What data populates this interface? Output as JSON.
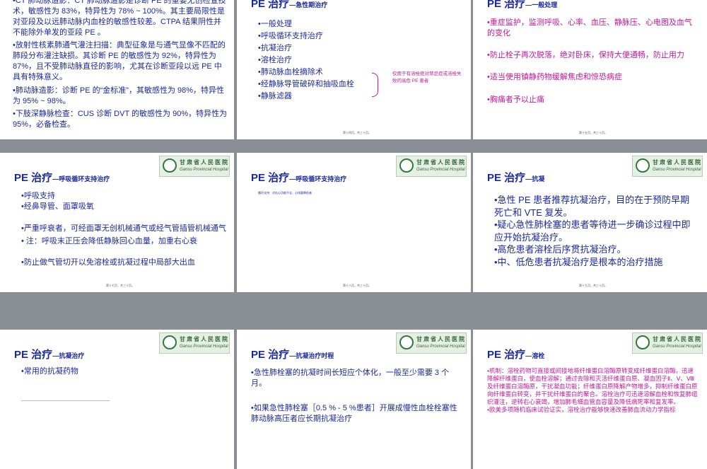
{
  "slides": [
    {
      "bullets": [
        "•CT 肺动脉造影：CT 肺动脉造影是诊断 PE 的重要无创检查技术，敏感性为 83%，特异性为 78% ~ 100%。其主要局限性是对亚段及以远肺动脉内血栓的敏感性较差。CTPA 结果阴性并不能除外单发的亚段 PE 。",
        "•放射性核素肺通气灌注扫描：典型征象是与通气显像不匹配的肺段分布灌注缺损。其诊断 PE 的敏感性为 92%，特异性为 87%，且不受肺动脉直径的影响，尤其在诊断亚段以远 PE 中具有特殊意义。",
        "•肺动脉造影：诊断 PE 的“金标准”，其敏感性为 98%，特异性为 95% ~ 98%。",
        "•下肢深静脉检查：CUS 诊断 DVT 的敏感性为 90%，特异性为 95%，必备检查。"
      ]
    },
    {
      "title": "PE 治疗",
      "subtitle": "—急性期治疗",
      "items": [
        "•一般处理",
        "•呼吸循环支持治疗",
        "•抗凝治疗",
        "•溶栓治疗",
        "•肺动脉血栓摘除术",
        "•经静脉导管破碎和抽吸血栓",
        "•静脉滤器"
      ],
      "brace_note": "仅用于有溶栓绝对禁忌症或溶栓失败的高危 PE 患者",
      "footer": "第十四页，共三十页。"
    },
    {
      "title": "PE 治疗",
      "subtitle": "—一般处理",
      "items": [
        "•重症监护，监测呼吸、心率、血压、静脉压、心电图及血气的变化",
        "•防止栓子再次脱落，绝对卧床，保持大便通畅，防止用力",
        "•适当使用镇静药物缓解焦虑和惊恐病症",
        "•胸痛者予以止痛"
      ],
      "footer": "第十五页，共三十页。"
    },
    {
      "title": "PE 治疗",
      "subtitle": "—呼吸循环支持治疗",
      "items": [
        "•呼吸支持",
        "•经鼻导管、面罩吸氧",
        "•严重呼衰者，可经面罩无创机械通气或经气管插管机械通气",
        "•  注：呼吸末正压会降低静脉回心血量，加重右心衰",
        "•防止做气管切开以免溶栓或抗凝过程中局部大出血"
      ],
      "footer": "第十七页，共三十页。"
    },
    {
      "title": "PE 治疗",
      "subtitle": "—呼吸循环支持治疗",
      "tiny_note": "循环支持：对右心功能不全、心排量降低者",
      "footer": "第十八页，共三十页。"
    },
    {
      "title": "PE 治疗",
      "subtitle": "—抗凝",
      "items": [
        "•急性 PE 患者推荐抗凝治疗，目的在于预防早期死亡和 VTE 复发。",
        "•疑心急性肺栓塞的患者等待进一步确诊过程中即应开始抗凝治疗。",
        "•高危患者溶栓后序贯抗凝治疗。",
        "•中、低危患者抗凝治疗是根本的治疗措施"
      ],
      "footer": "第十九页，共三十页。"
    },
    {
      "title": "PE 治疗",
      "subtitle": "—抗凝治疗",
      "items": [
        "•常用的抗凝药物"
      ]
    },
    {
      "title": "PE 治疗",
      "subtitle": "—抗凝治疗时程",
      "items": [
        "•急性肺栓塞的抗凝时间长短应个体化，一般至少需要 3 个月。",
        "•如果急性肺栓塞［0.5 % - 5 %患者］开展成慢性血栓栓塞性肺动脉高压者应长期抗凝治疗"
      ]
    },
    {
      "title": "PE 治疗",
      "subtitle": "—溶栓",
      "items": [
        "•机制：溶栓药物可直接或间接地将纤维蛋白溶酶原转变成纤维蛋白溶酶，迅速降解纤维蛋白，使血栓溶解；通过去除和灭活纤维蛋白原、凝血因子Ⅱ、Ⅴ、Ⅷ及纤维蛋白溶酶原，干扰凝血功能；纤维蛋白原降解产物增多，抑制纤维蛋白原向纤维蛋白转变，并干扰纤维蛋白的聚合。溶栓治疗可迅速溶解血栓和恢复肺组织灌注，逆转右心衰竭，增加肺毛细血管血容量及降低病死率和复发率。",
        "•欧美多项随机临床试验证实，溶栓治疗能够快速改善肺血流动力学指标"
      ]
    }
  ],
  "logo": {
    "cn": "甘肃省人民医院",
    "en": "Gansu Provincial Hospital"
  }
}
